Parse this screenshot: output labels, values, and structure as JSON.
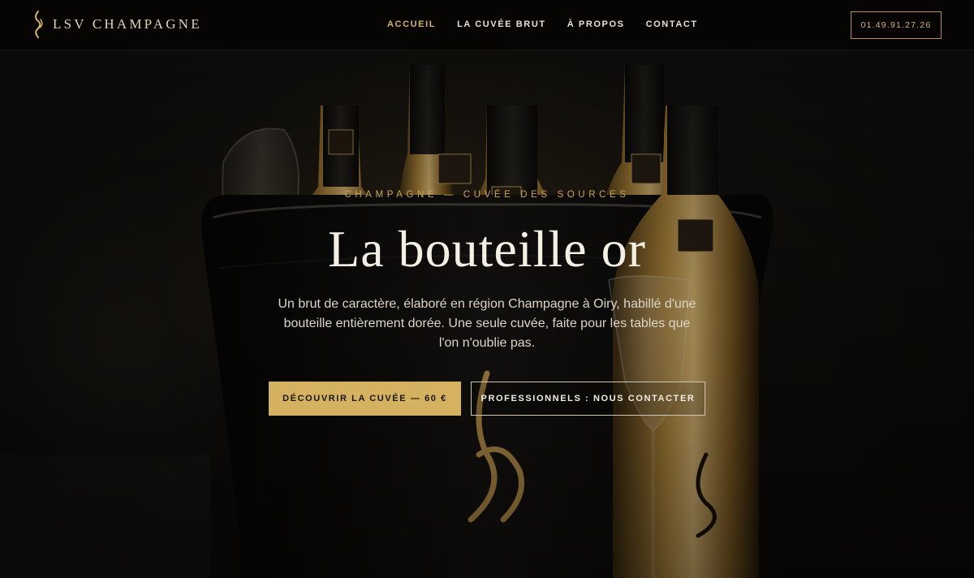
{
  "header": {
    "brand_name": "LSV CHAMPAGNE",
    "nav": [
      {
        "label": "ACCUEIL",
        "active": true
      },
      {
        "label": "LA CUVÉE BRUT",
        "active": false
      },
      {
        "label": "À PROPOS",
        "active": false
      },
      {
        "label": "CONTACT",
        "active": false
      }
    ],
    "phone": "01.49.91.27.26"
  },
  "hero": {
    "kicker": "CHAMPAGNE — CUVÉE DES SOURCES",
    "title": "La bouteille or",
    "lead": "Un brut de caractère, élaboré en région Champagne à Oiry, habillé d'une bouteille entièrement dorée. Une seule cuvée, faite pour les tables que l'on n'oublie pas.",
    "cta_primary": "DÉCOUVRIR LA CUVÉE — 60 €",
    "cta_secondary": "PROFESSIONNELS : NOUS CONTACTER"
  },
  "colors": {
    "accent_gold": "#d4b262",
    "header_bg": "#060504",
    "text_light": "#f4efe4"
  },
  "icons": {
    "brand_logo": "lsv-monogram-icon"
  }
}
